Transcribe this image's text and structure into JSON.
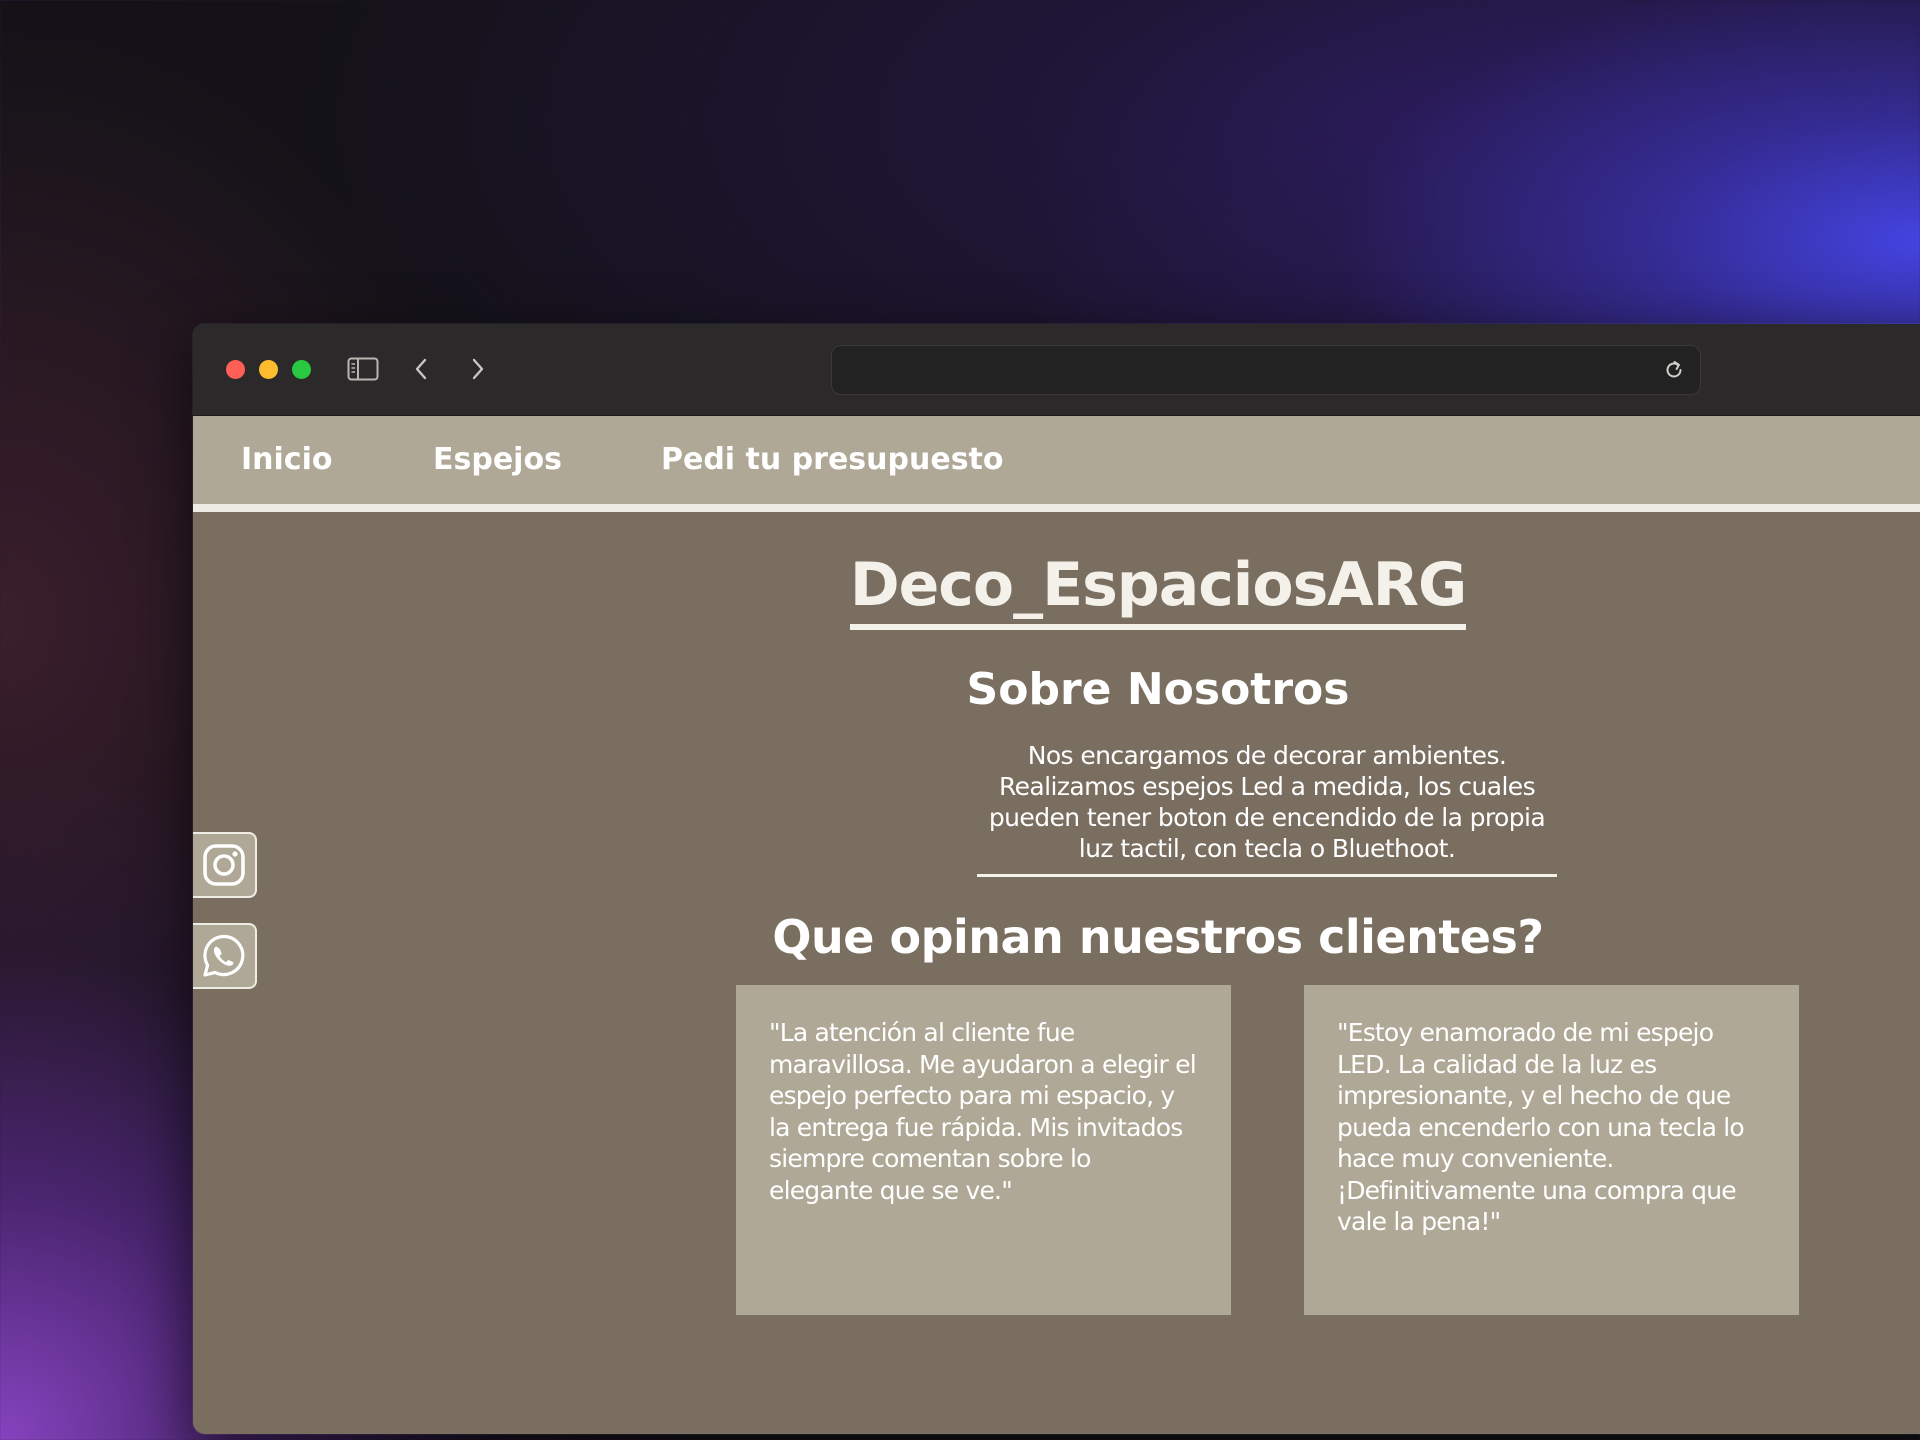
{
  "browser": {
    "url": "",
    "icons": {
      "sidebar": "sidebar-toggle-icon",
      "back": "chevron-left-icon",
      "forward": "chevron-right-icon",
      "reload": "reload-icon"
    },
    "traffic_lights": [
      "#ff5f57",
      "#febc2e",
      "#28c840"
    ]
  },
  "nav": {
    "items": [
      {
        "label": "Inicio"
      },
      {
        "label": "Espejos"
      },
      {
        "label": "Pedi tu presupuesto"
      }
    ]
  },
  "social": {
    "items": [
      {
        "icon": "instagram-icon"
      },
      {
        "icon": "whatsapp-icon"
      }
    ]
  },
  "brand": {
    "title": "Deco_EspaciosARG"
  },
  "about": {
    "title": "Sobre Nosotros",
    "text": "Nos encargamos de decorar ambientes. Realizamos espejos Led a medida, los cuales pueden tener boton de encendido de la propia luz tactil, con tecla o Bluethoot."
  },
  "testimonials": {
    "title": "Que opinan nuestros clientes?",
    "items": [
      {
        "text": "\"La atención al cliente fue maravillosa. Me ayudaron a elegir el espejo perfecto para mi espacio, y la entrega fue rápida. Mis invitados siempre comentan sobre lo elegante que se ve.\""
      },
      {
        "text": "\"Estoy enamorado de mi espejo LED. La calidad de la luz es impresionante, y el hecho de que pueda encenderlo con una tecla lo hace muy conveniente. ¡Definitivamente una compra que vale la pena!\""
      }
    ]
  },
  "colors": {
    "page_bg": "#796e5f",
    "accent_panel": "#b0a896",
    "rule": "#efece4",
    "titlebar": "#2b2929"
  }
}
